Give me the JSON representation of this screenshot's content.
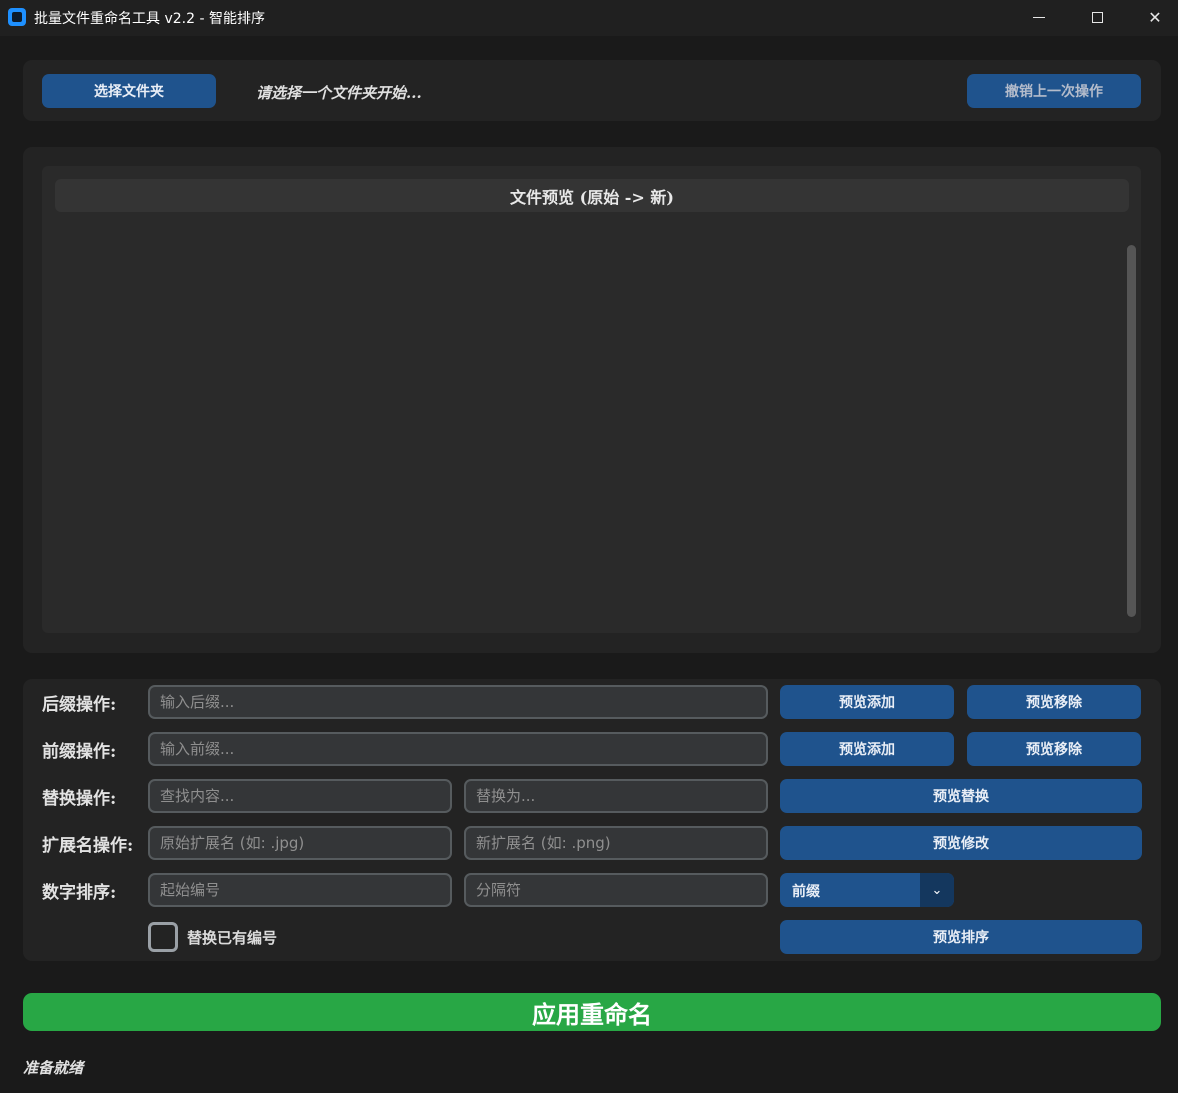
{
  "window": {
    "title": "批量文件重命名工具 v2.2 - 智能排序",
    "controls": {
      "minimize_icon": "minimize-icon",
      "maximize_icon": "maximize-icon",
      "close_glyph": "✕"
    }
  },
  "top": {
    "select_folder_label": "选择文件夹",
    "folder_status": "请选择一个文件夹开始...",
    "undo_label": "撤销上一次操作"
  },
  "preview": {
    "header": "文件预览 (原始 -> 新)"
  },
  "suffix": {
    "label": "后缀操作:",
    "placeholder": "输入后缀...",
    "add_label": "预览添加",
    "remove_label": "预览移除"
  },
  "prefix": {
    "label": "前缀操作:",
    "placeholder": "输入前缀...",
    "add_label": "预览添加",
    "remove_label": "预览移除"
  },
  "replace": {
    "label": "替换操作:",
    "find_placeholder": "查找内容...",
    "replace_placeholder": "替换为...",
    "button_label": "预览替换"
  },
  "extension": {
    "label": "扩展名操作:",
    "old_placeholder": "原始扩展名 (如: .jpg)",
    "new_placeholder": "新扩展名 (如: .png)",
    "button_label": "预览修改"
  },
  "numbering": {
    "label": "数字排序:",
    "start_placeholder": "起始编号",
    "separator_placeholder": "分隔符",
    "position_selected": "前缀",
    "replace_existing_label": "替换已有编号",
    "replace_existing_checked": false,
    "button_label": "预览排序"
  },
  "apply_label": "应用重命名",
  "status": "准备就绪",
  "colors": {
    "background": "#1a1a1a",
    "panel": "#232323",
    "button_blue": "#1f538d",
    "apply_green": "#28a745"
  }
}
